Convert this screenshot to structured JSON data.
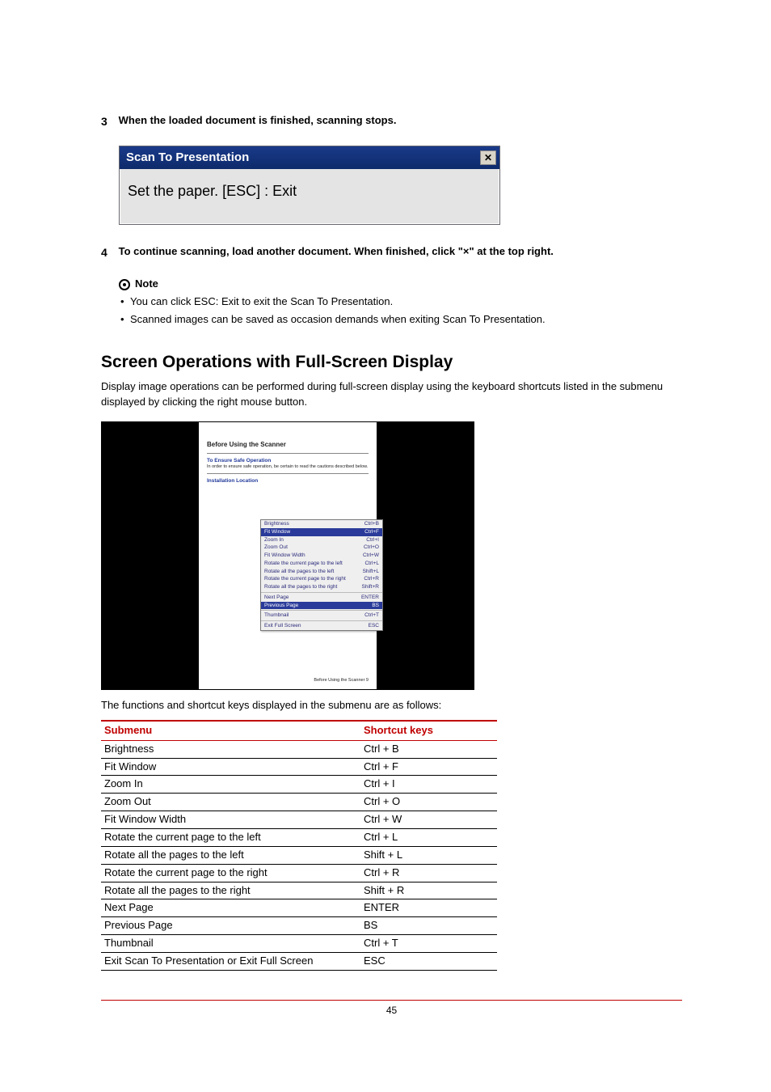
{
  "steps": {
    "s3": {
      "num": "3",
      "text": "When the loaded document is finished, scanning stops."
    },
    "s4": {
      "num": "4",
      "text": "To continue scanning, load another document. When finished, click \"×\" at the top right."
    }
  },
  "dialog": {
    "title": "Scan To Presentation",
    "body": "Set the paper.   [ESC] : Exit",
    "close_glyph": "✕"
  },
  "note": {
    "label": "Note",
    "items": [
      "You can click ESC: Exit to exit the Scan To Presentation.",
      "Scanned images can be saved as occasion demands when exiting Scan To Presentation."
    ]
  },
  "section_title": "Screen Operations with Full-Screen Display",
  "section_para": "Display image operations can be performed during full-screen display using the keyboard shortcuts listed in the submenu displayed by clicking the right mouse button.",
  "screenshot": {
    "doc_heading": "Before Using the Scanner",
    "doc_sub1": "To Ensure Safe Operation",
    "doc_sub1_text": "In order to ensure safe operation, be certain to read the cautions described below.",
    "doc_sub2": "Installation Location",
    "doc_footer": "Before Using the Scanner      9",
    "menu": [
      {
        "label": "Brightness",
        "key": "Ctrl+B",
        "hi": false
      },
      {
        "label": "Fit Window",
        "key": "Ctrl+F",
        "hi": true
      },
      {
        "label": "Zoom In",
        "key": "Ctrl+I",
        "hi": false
      },
      {
        "label": "Zoom Out",
        "key": "Ctrl+O",
        "hi": false
      },
      {
        "label": "Fit Window Width",
        "key": "Ctrl+W",
        "hi": false
      },
      {
        "label": "Rotate the current page to the left",
        "key": "Ctrl+L",
        "hi": false
      },
      {
        "label": "Rotate all the pages to the left",
        "key": "Shift+L",
        "hi": false
      },
      {
        "label": "Rotate the current page to the right",
        "key": "Ctrl+R",
        "hi": false
      },
      {
        "label": "Rotate all the pages to the right",
        "key": "Shift+R",
        "hi": false
      },
      {
        "label": "Next Page",
        "key": "ENTER",
        "hi": false
      },
      {
        "label": "Previous Page",
        "key": "BS",
        "hi": true
      },
      {
        "label": "Thumbnail",
        "key": "Ctrl+T",
        "hi": false
      },
      {
        "label": "Exit Full Screen",
        "key": "ESC",
        "hi": false
      }
    ]
  },
  "table_caption": "The functions and shortcut keys displayed in the submenu are as follows:",
  "table": {
    "head": {
      "c1": "Submenu",
      "c2": "Shortcut keys"
    },
    "rows": [
      {
        "c1": "Brightness",
        "c2": "Ctrl + B"
      },
      {
        "c1": "Fit Window",
        "c2": "Ctrl + F"
      },
      {
        "c1": "Zoom In",
        "c2": "Ctrl + I"
      },
      {
        "c1": "Zoom Out",
        "c2": "Ctrl + O"
      },
      {
        "c1": "Fit Window Width",
        "c2": "Ctrl + W"
      },
      {
        "c1": "Rotate the current page to the left",
        "c2": "Ctrl + L"
      },
      {
        "c1": "Rotate all the pages to the left",
        "c2": "Shift + L"
      },
      {
        "c1": "Rotate the current page to the right",
        "c2": "Ctrl + R"
      },
      {
        "c1": "Rotate all the pages to the right",
        "c2": "Shift + R"
      },
      {
        "c1": "Next Page",
        "c2": "ENTER"
      },
      {
        "c1": "Previous Page",
        "c2": "BS"
      },
      {
        "c1": "Thumbnail",
        "c2": "Ctrl + T"
      },
      {
        "c1": "Exit Scan To Presentation or Exit Full Screen",
        "c2": "ESC"
      }
    ]
  },
  "page_number": "45"
}
